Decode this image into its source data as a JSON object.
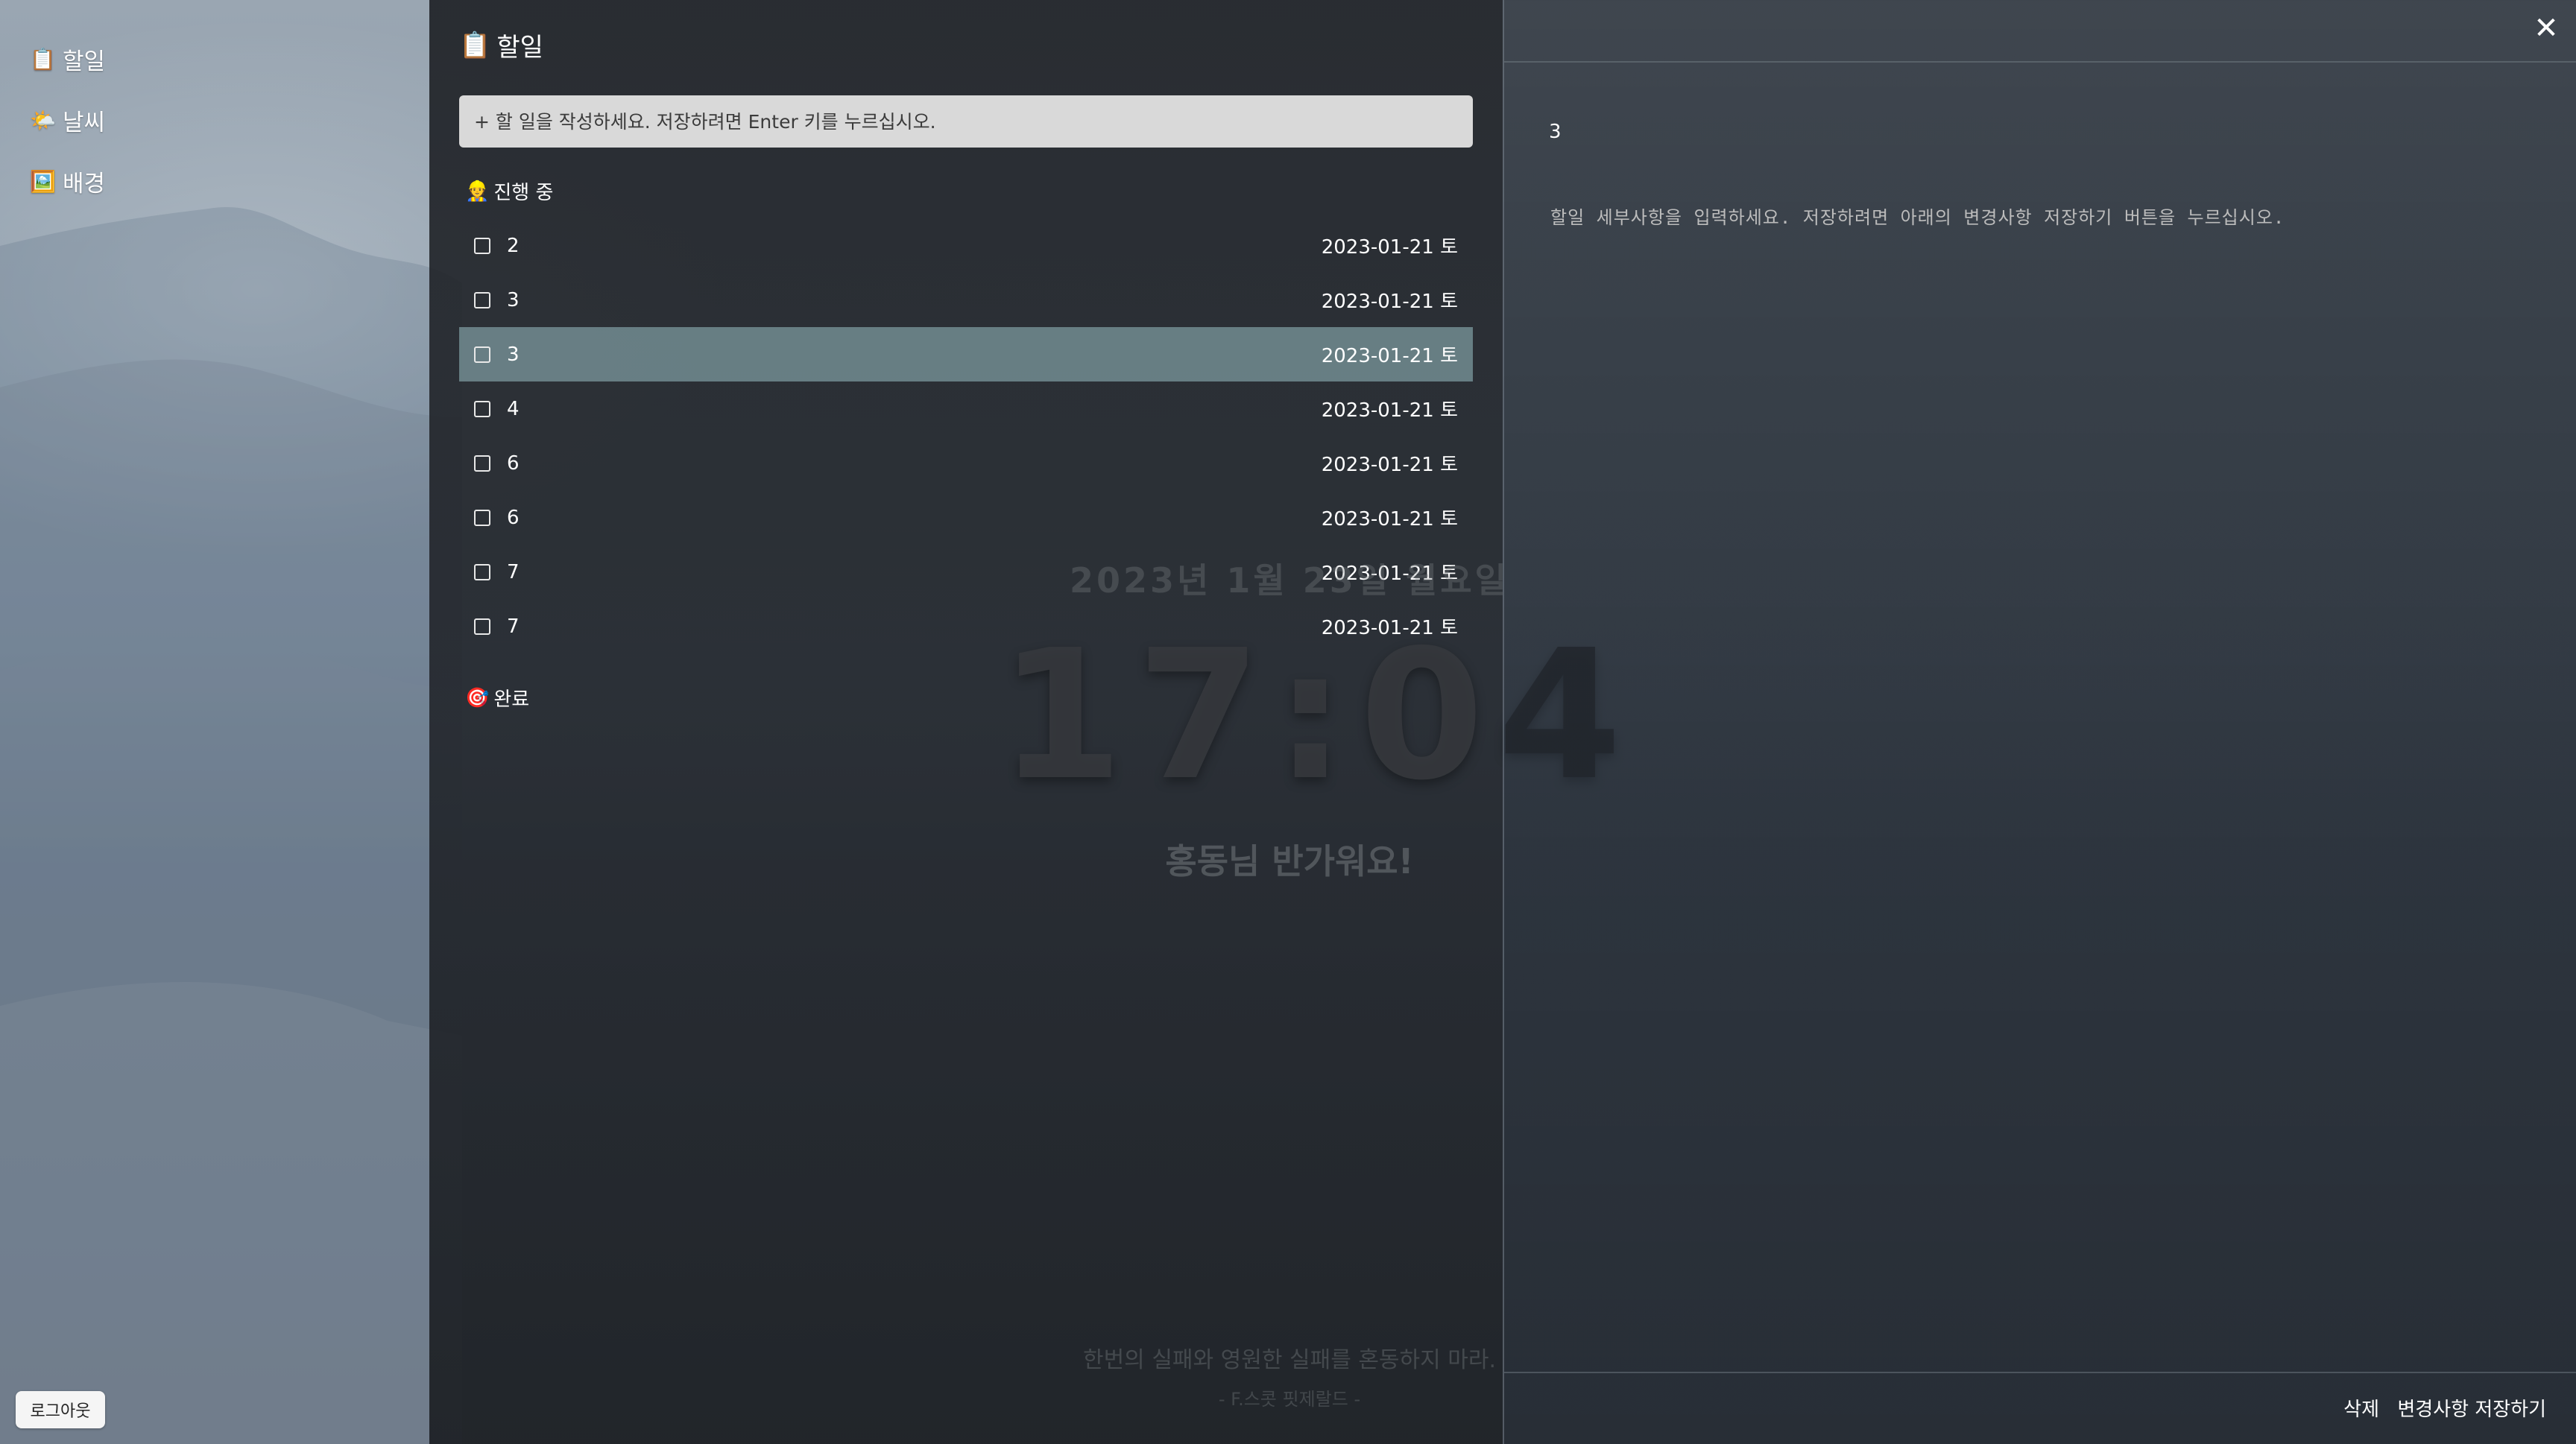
{
  "sidebar": {
    "items": [
      {
        "icon": "📋",
        "label": "할일"
      },
      {
        "icon": "🌤️",
        "label": "날씨"
      },
      {
        "icon": "🖼️",
        "label": "배경"
      }
    ],
    "logout_label": "로그아웃"
  },
  "overlay": {
    "date": "2023년 1월 23일 월요일",
    "time": "17:04",
    "greeting": "홍동님 반가워요!",
    "quote": "한번의 실패와 영원한 실패를 혼동하지 마라.",
    "author": "- F.스콧 핏제랄드 -"
  },
  "todo": {
    "title_icon": "📋",
    "title": "할일",
    "input_placeholder": "+ 할 일을 작성하세요. 저장하려면 Enter 키를 누르십시오.",
    "in_progress": {
      "icon": "👷",
      "label": "진행 중"
    },
    "done": {
      "icon": "🎯",
      "label": "완료"
    },
    "items": [
      {
        "text": "2",
        "date": "2023-01-21 토"
      },
      {
        "text": "3",
        "date": "2023-01-21 토"
      },
      {
        "text": "3",
        "date": "2023-01-21 토"
      },
      {
        "text": "4",
        "date": "2023-01-21 토"
      },
      {
        "text": "6",
        "date": "2023-01-21 토"
      },
      {
        "text": "6",
        "date": "2023-01-21 토"
      },
      {
        "text": "7",
        "date": "2023-01-21 토"
      },
      {
        "text": "7",
        "date": "2023-01-21 토"
      }
    ]
  },
  "detail": {
    "close_glyph": "✕",
    "title": "3",
    "body_placeholder": "할일 세부사항을 입력하세요. 저장하려면 아래의 변경사항 저장하기 버튼을 누르십시오.",
    "delete_label": "삭제",
    "save_label": "변경사항 저장하기"
  }
}
